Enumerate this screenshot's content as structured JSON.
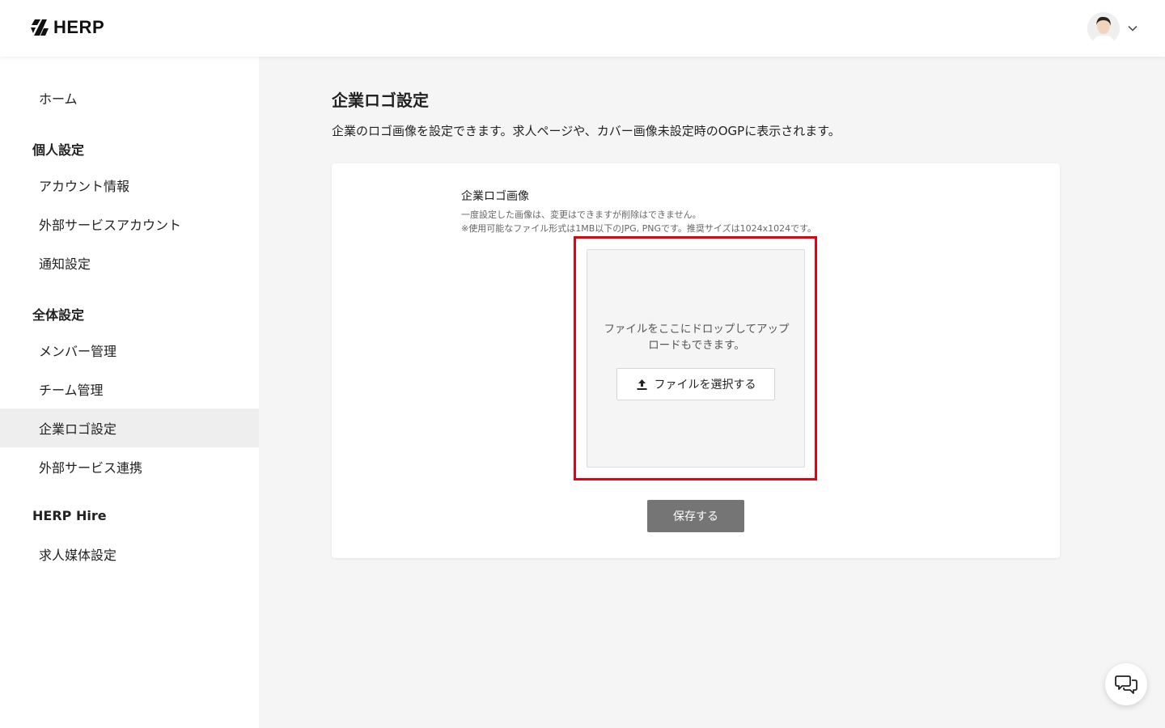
{
  "header": {
    "logo_text": "HERP",
    "user_avatar_alt": "user avatar"
  },
  "sidebar": {
    "home": "ホーム",
    "personal_heading": "個人設定",
    "personal_items": [
      "アカウント情報",
      "外部サービスアカウント",
      "通知設定"
    ],
    "global_heading": "全体設定",
    "global_items": [
      "メンバー管理",
      "チーム管理",
      "企業ロゴ設定",
      "外部サービス連携"
    ],
    "hire_heading": "HERP Hire",
    "hire_items": [
      "求人媒体設定"
    ],
    "active_item": "企業ロゴ設定"
  },
  "main": {
    "title": "企業ロゴ設定",
    "description": "企業のロゴ画像を設定できます。求人ページや、カバー画像未設定時のOGPに表示されます。",
    "field_label": "企業ロゴ画像",
    "help_line1": "一度設定した画像は、変更はできますが削除はできません。",
    "help_line2": "※使用可能なファイル形式は1MB以下のJPG, PNGです。推奨サイズは1024x1024です。",
    "drop_text": "ファイルをここにドロップしてアップロードもできます。",
    "select_file_label": "ファイルを選択する",
    "save_label": "保存する"
  },
  "colors": {
    "highlight": "#e60012",
    "save_button": "#757575",
    "active_nav_bg": "#eeeeee"
  },
  "icons": {
    "logo": "herp-logo-icon",
    "chevron": "chevron-down-icon",
    "upload": "upload-icon",
    "chat": "chat-bubbles-icon"
  }
}
